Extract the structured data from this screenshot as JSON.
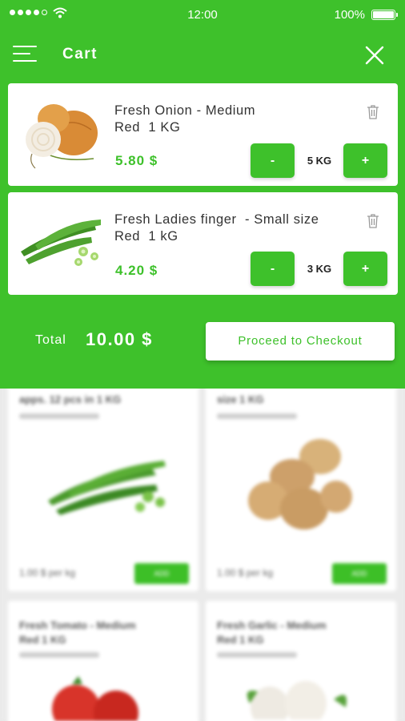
{
  "status_bar": {
    "time": "12:00",
    "battery": "100%"
  },
  "header": {
    "title": "Cart"
  },
  "cart_items": [
    {
      "name": "Fresh Onion - Medium\nRed  1 KG",
      "price": "5.80 $",
      "quantity": "5 KG",
      "minus_label": "-",
      "plus_label": "+"
    },
    {
      "name": "Fresh Ladies finger  - Small size\nRed  1 kG",
      "price": "4.20 $",
      "quantity": "3 KG",
      "minus_label": "-",
      "plus_label": "+"
    }
  ],
  "summary": {
    "total_label": "Total",
    "total_value": "10.00 $",
    "checkout_label": "Proceed to Checkout"
  },
  "background_products": [
    {
      "title_line": "apps. 12 pcs in 1 KG",
      "price": "1.00 $",
      "unit": "per kg",
      "add_label": "ADD"
    },
    {
      "title_line": "size 1 KG",
      "price": "1.00 $",
      "unit": "per kg",
      "add_label": "ADD"
    },
    {
      "title": "Fresh Tomato - Medium\nRed 1 KG"
    },
    {
      "title": "Fresh Garlic - Medium\nRed 1 KG"
    }
  ],
  "colors": {
    "accent": "#3ec12b",
    "card": "#ffffff",
    "text": "#333333"
  },
  "icons": {
    "menu": "menu-icon",
    "close": "close-icon",
    "delete": "trash-icon",
    "wifi": "wifi-icon",
    "battery": "battery-icon"
  }
}
